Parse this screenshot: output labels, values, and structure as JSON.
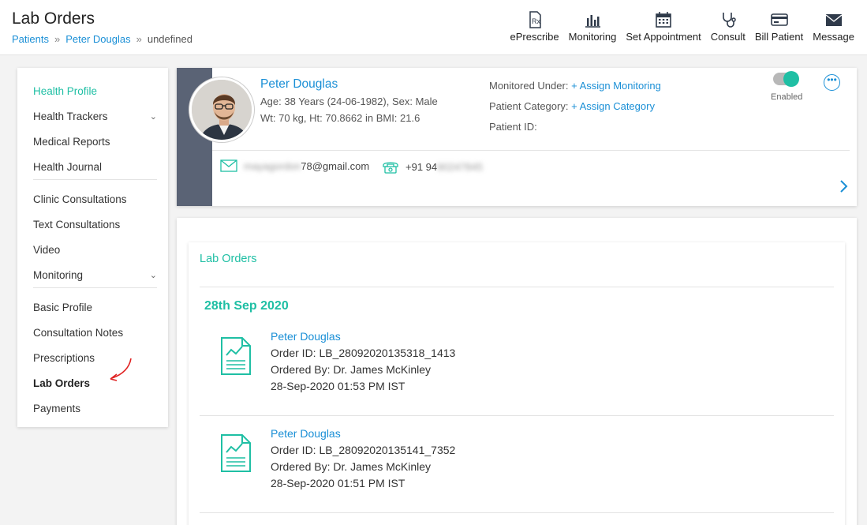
{
  "header": {
    "title": "Lab Orders",
    "breadcrumb": [
      "Patients",
      "Peter Douglas",
      "undefined"
    ],
    "breadcrumb_sep": "»",
    "actions": [
      {
        "label": "ePrescribe",
        "icon": "prescription-icon"
      },
      {
        "label": "Monitoring",
        "icon": "bar-chart-icon"
      },
      {
        "label": "Set Appointment",
        "icon": "calendar-icon"
      },
      {
        "label": "Consult",
        "icon": "stethoscope-icon"
      },
      {
        "label": "Bill Patient",
        "icon": "credit-card-icon"
      },
      {
        "label": "Message",
        "icon": "envelope-icon"
      }
    ]
  },
  "sidebar": {
    "items": [
      {
        "label": "Health Profile",
        "style": "teal"
      },
      {
        "label": "Health Trackers",
        "chevron": "⌄"
      },
      {
        "label": "Medical Reports"
      },
      {
        "label": "Health Journal"
      },
      {
        "label": "Clinic Consultations"
      },
      {
        "label": "Text Consultations"
      },
      {
        "label": "Video"
      },
      {
        "label": "Monitoring",
        "chevron": "⌄"
      },
      {
        "label": "Basic Profile"
      },
      {
        "label": "Consultation Notes"
      },
      {
        "label": "Prescriptions"
      },
      {
        "label": "Lab Orders",
        "style": "bold"
      },
      {
        "label": "Payments"
      }
    ]
  },
  "patient": {
    "name": "Peter Douglas",
    "age_sex": "Age: 38 Years (24-06-1982), Sex: Male",
    "wt_ht": "Wt: 70 kg, Ht: 70.8662 in BMI: 21.6",
    "monitored_label": "Monitored Under:",
    "assign_monitoring": "+ Assign Monitoring",
    "category_label": "Patient Category:",
    "assign_category": "+ Assign Category",
    "patient_id_label": "Patient ID:",
    "toggle_label": "Enabled",
    "more": "•••",
    "email_visible": "78@gmail.com",
    "email_blurred": "mayagordon",
    "phone_visible": "+91 94",
    "phone_blurred": "90247845",
    "colors": {
      "accent": "#1fbfa4",
      "link": "#1a8fd6",
      "strip": "#5a6375"
    }
  },
  "lab_orders": {
    "title": "Lab Orders",
    "date": "28th Sep 2020",
    "orders": [
      {
        "name": "Peter Douglas",
        "order_id": "Order ID: LB_28092020135318_1413",
        "ordered_by": "Ordered By: Dr. James McKinley",
        "time": "28-Sep-2020 01:53 PM IST"
      },
      {
        "name": "Peter Douglas",
        "order_id": "Order ID: LB_28092020135141_7352",
        "ordered_by": "Ordered By: Dr. James McKinley",
        "time": "28-Sep-2020 01:51 PM IST"
      }
    ]
  }
}
